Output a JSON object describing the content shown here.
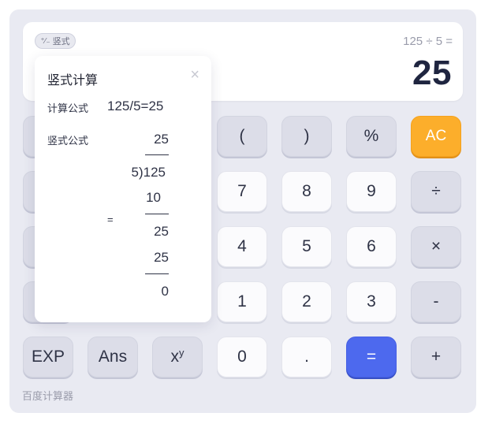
{
  "display": {
    "mode_tag": "竖式",
    "mode_icon": "plus-minus-icon",
    "expression": "125 ÷ 5 =",
    "result": "25"
  },
  "keys": {
    "lparen": "(",
    "rparen": ")",
    "percent": "%",
    "ac": "AC",
    "seven": "7",
    "eight": "8",
    "nine": "9",
    "divide": "÷",
    "four": "4",
    "five": "5",
    "six": "6",
    "multiply": "×",
    "one": "1",
    "two": "2",
    "three": "3",
    "minus": "-",
    "exp": "EXP",
    "ans": "Ans",
    "power_base": "x",
    "power_exp": "y",
    "zero": "0",
    "dot": ".",
    "equals": "=",
    "plus": "+"
  },
  "popup": {
    "title": "竖式计算",
    "close": "×",
    "formula_label": "计算公式",
    "formula": "125/5=25",
    "vertical_label": "竖式公式",
    "quotient": "25",
    "divisor_dividend": "5)125",
    "sub1": "10",
    "rem1": "25",
    "sub2": "25",
    "remainder": "0",
    "equals_sign": "="
  },
  "footer": "百度计算器",
  "colors": {
    "panel": "#e9eaf2",
    "ac": "#fcae2b",
    "equals": "#4d69ee",
    "result_text": "#1f2540"
  }
}
